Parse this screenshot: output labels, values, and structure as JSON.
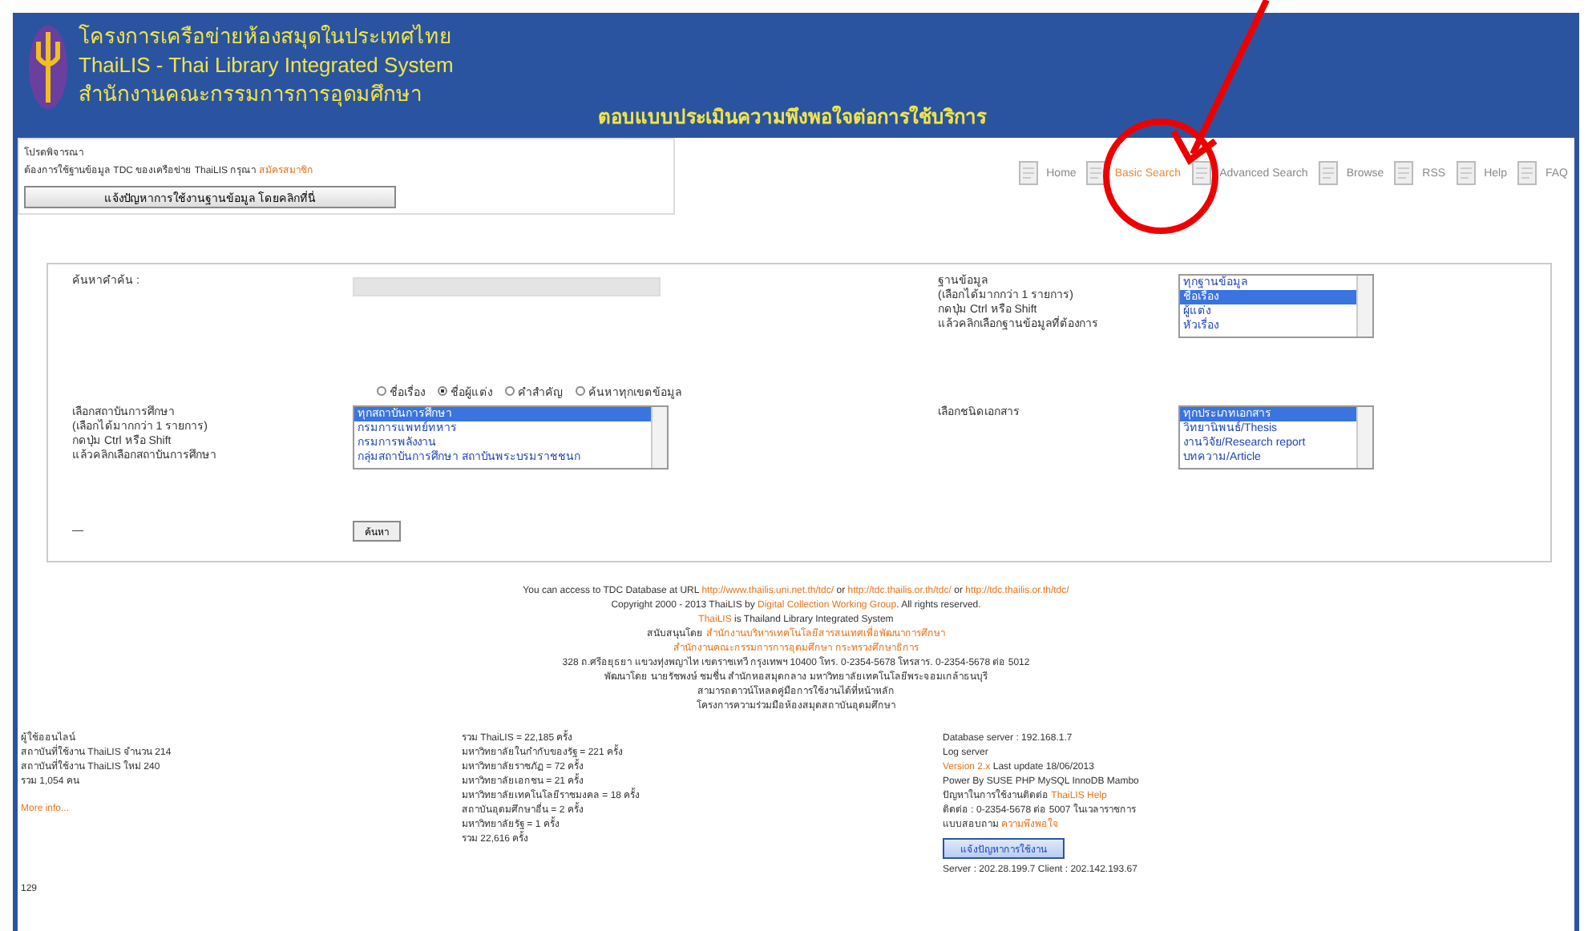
{
  "header": {
    "lines": [
      "โครงการเครือข่ายห้องสมุดในประเทศไทย",
      "ThaiLIS - Thai Library Integrated System",
      "สำนักงานคณะกรรมการการอุดมศึกษา"
    ],
    "banner": "ตอบแบบประเมินความพึงพอใจต่อการใช้บริการ"
  },
  "notice": {
    "lines": [
      [
        {
          "text": "โปรดพิจารณา"
        }
      ],
      [
        {
          "text": "ต้องการใช้ฐานข้อมูล TDC ของเครือข่าย ThaiLIS กรุณา "
        },
        {
          "text": "สมัครสมาชิก",
          "link": true
        }
      ]
    ],
    "button": "แจ้งปัญหาการใช้งานฐานข้อมูล โดยคลิกที่นี่"
  },
  "nav": [
    {
      "label": "Home",
      "selected": false
    },
    {
      "label": "Basic Search",
      "selected": true
    },
    {
      "label": "Advanced Search",
      "selected": false
    },
    {
      "label": "Browse",
      "selected": false
    },
    {
      "label": "RSS",
      "selected": false
    },
    {
      "label": "Help",
      "selected": false
    },
    {
      "label": "FAQ",
      "selected": false
    }
  ],
  "form": {
    "search_label": "ค้นหาคำค้น :",
    "db_label": [
      "ฐานข้อมูล",
      "(เลือกได้มากกว่า 1 รายการ)",
      "กดปุ่ม Ctrl หรือ Shift",
      "แล้วคลิกเลือกฐานข้อมูลที่ต้องการ"
    ],
    "db_options": [
      {
        "label": "ทุกฐานข้อมูล",
        "selected": false
      },
      {
        "label": "ชื่อเรื่อง",
        "selected": true
      },
      {
        "label": "ผู้แต่ง",
        "selected": false
      },
      {
        "label": "หัวเรื่อง",
        "selected": false
      }
    ],
    "radios": [
      {
        "label": "ชื่อเรื่อง",
        "selected": false
      },
      {
        "label": "ชื่อผู้แต่ง",
        "selected": true
      },
      {
        "label": "คำสำคัญ",
        "selected": false
      },
      {
        "label": "ค้นหาทุกเขตข้อมูล",
        "selected": false
      }
    ],
    "inst_label": [
      "เลือกสถาบันการศึกษา",
      "(เลือกได้มากกว่า 1 รายการ)",
      "กดปุ่ม Ctrl หรือ Shift",
      "แล้วคลิกเลือกสถาบันการศึกษา"
    ],
    "inst_options": [
      {
        "label": "ทุกสถาบันการศึกษา",
        "selected": true
      },
      {
        "label": "กรมการแพทย์ทหาร",
        "selected": false
      },
      {
        "label": "กรมการพลังงาน",
        "selected": false
      },
      {
        "label": "กลุ่มสถาบันการศึกษา สถาบันพระบรมราชชนก",
        "selected": false
      }
    ],
    "type_label": "เลือกชนิดเอกสาร",
    "type_options": [
      {
        "label": "ทุกประเภทเอกสาร",
        "selected": true
      },
      {
        "label": "วิทยานิพนธ์/Thesis",
        "selected": false
      },
      {
        "label": "งานวิจัย/Research report",
        "selected": false
      },
      {
        "label": "บทความ/Article",
        "selected": false
      }
    ],
    "submit": "ค้นหา",
    "dash": "—"
  },
  "footer": [
    [
      {
        "text": "You can access to TDC Database at URL "
      },
      {
        "text": "http://www.thailis.uni.net.th/tdc/",
        "link": true
      },
      {
        "text": " or "
      },
      {
        "text": "http://tdc.thailis.or.th/tdc/",
        "link": true
      },
      {
        "text": " or "
      },
      {
        "text": "http://tdc.thailis.or.th/tdc/",
        "link": true
      }
    ],
    [
      {
        "text": "Copyright 2000 - 2013 ThaiLIS by "
      },
      {
        "text": "Digital Collection Working Group",
        "link": true
      },
      {
        "text": ". All rights reserved."
      }
    ],
    [
      {
        "text": "ThaiLIS",
        "link": true
      },
      {
        "text": " is Thailand Library Integrated System"
      }
    ],
    [
      {
        "text": "สนับสนุนโดย "
      },
      {
        "text": "สำนักงานบริหารเทคโนโลยีสารสนเทศเพื่อพัฒนาการศึกษา",
        "link": true
      }
    ],
    [
      {
        "text": "สำนักงานคณะกรรมการการอุดมศึกษา กระทรวงศึกษาธิการ",
        "link": true
      }
    ],
    [
      {
        "text": "328 ถ.ศรีอยุธยา แขวงทุ่งพญาไท เขตราชเทวี กรุงเทพฯ 10400 โทร. 0-2354-5678 โทรสาร. 0-2354-5678 ต่อ 5012"
      }
    ],
    [
      {
        "text": "พัฒนาโดย นายรัชพงษ์ ชมชื่น สำนักหอสมุดกลาง มหาวิทยาลัยเทคโนโลยีพระจอมเกล้าธนบุรี"
      }
    ],
    [
      {
        "text": "สามารถดาวน์โหลดคู่มือการใช้งานได้ที่หน้าหลัก"
      }
    ],
    [
      {
        "text": "โครงการความร่วมมือห้องสมุดสถาบันอุดมศึกษา"
      }
    ]
  ],
  "stats": [
    [
      [
        {
          "text": "ผู้ใช้ออนไลน์"
        }
      ],
      [
        {
          "text": "สถาบันที่ใช้งาน ThaiLIS จำนวน 214"
        }
      ],
      [
        {
          "text": "สถาบันที่ใช้งาน ThaiLIS ใหม่ 240"
        }
      ],
      [
        {
          "text": "รวม 1,054 คน"
        }
      ],
      [
        {
          "text": "More info...",
          "link": true
        }
      ]
    ],
    [
      [
        {
          "text": "รวม ThaiLIS = 22,185 ครั้ง"
        }
      ],
      [
        {
          "text": "มหาวิทยาลัยในกำกับของรัฐ = 221 ครั้ง"
        }
      ],
      [
        {
          "text": "มหาวิทยาลัยราชภัฏ = 72 ครั้ง"
        }
      ],
      [
        {
          "text": "มหาวิทยาลัยเอกชน = 21 ครั้ง"
        }
      ],
      [
        {
          "text": "มหาวิทยาลัยเทคโนโลยีราชมงคล = 18 ครั้ง"
        }
      ],
      [
        {
          "text": "สถาบันอุดมศึกษาอื่น = 2 ครั้ง"
        }
      ],
      [
        {
          "text": "มหาวิทยาลัยรัฐ = 1 ครั้ง"
        }
      ],
      [
        {
          "text": "รวม 22,616 ครั้ง"
        }
      ]
    ],
    [
      [
        {
          "text": "Database server : 192.168.1.7"
        }
      ],
      [
        {
          "text": "Log server"
        }
      ],
      [
        {
          "text": "Version 2.x",
          "link": true
        },
        {
          "text": " Last update 18/06/2013"
        }
      ],
      [
        {
          "text": "Power By SUSE PHP MySQL InnoDB Mambo"
        }
      ],
      [
        {
          "text": "ปัญหาในการใช้งานติดต่อ "
        },
        {
          "text": "ThaiLIS Help",
          "link": true
        }
      ],
      [
        {
          "text": "ติดต่อ : 0-2354-5678 ต่อ 5007 ในเวลาราชการ"
        }
      ],
      [
        {
          "text": "แบบสอบถาม "
        },
        {
          "text": "ความพึงพอใจ",
          "link": true
        }
      ]
    ]
  ],
  "report_button": "แจ้งปัญหาการใช้งาน",
  "server_line": "Server : 202.28.199.7   Client : 202.142.193.67",
  "page_number": "129"
}
